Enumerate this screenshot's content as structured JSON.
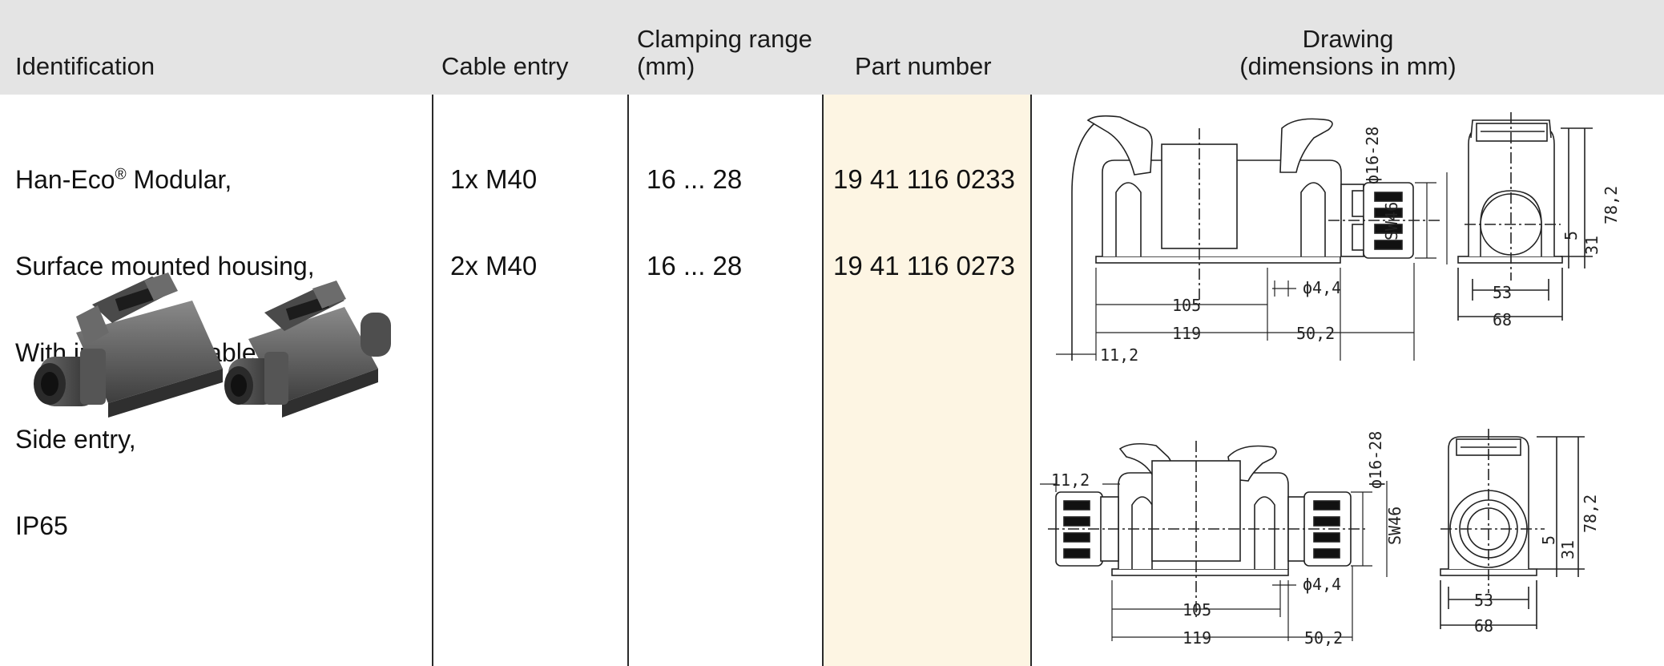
{
  "header": {
    "identification": "Identification",
    "cable_entry": "Cable entry",
    "clamping_range_line1": "Clamping range",
    "clamping_range_line2": "(mm)",
    "part_number": "Part number",
    "drawing_line1": "Drawing",
    "drawing_line2": "(dimensions in mm)"
  },
  "row": {
    "identification": {
      "line1_brand": "Han-Eco",
      "line1_reg": "®",
      "line1_rest": " Modular,",
      "line2": "Surface mounted housing,",
      "line3": "With integrated cable gland,",
      "line4": "Side entry,",
      "line5": "IP65"
    },
    "cable_entries": [
      "1x M40",
      "2x M40"
    ],
    "clamping_ranges": [
      "16 ... 28",
      "16 ... 28"
    ],
    "part_numbers": [
      "19 41 116 0233",
      "19 41 116 0273"
    ]
  },
  "drawing": {
    "top": {
      "dia_gland": "ϕ16-28",
      "sw": "SW46",
      "hole": "ϕ4,4",
      "len_105": "105",
      "len_119": "119",
      "len_50_2": "50,2",
      "len_11_2": "11,2",
      "side_53": "53",
      "side_68": "68",
      "side_5": "5",
      "side_31": "31",
      "side_78_2": "78,2"
    },
    "bottom": {
      "dia_gland": "ϕ16-28",
      "sw": "SW46",
      "hole": "ϕ4,4",
      "len_105": "105",
      "len_119": "119",
      "len_50_2": "50,2",
      "len_11_2": "11,2",
      "side_53": "53",
      "side_68": "68",
      "side_5": "5",
      "side_31": "31",
      "side_78_2": "78,2"
    }
  },
  "colors": {
    "header_bg": "#e4e4e4",
    "part_number_bg": "#fdf5e3",
    "housing_gray": "#5a5a5a"
  }
}
